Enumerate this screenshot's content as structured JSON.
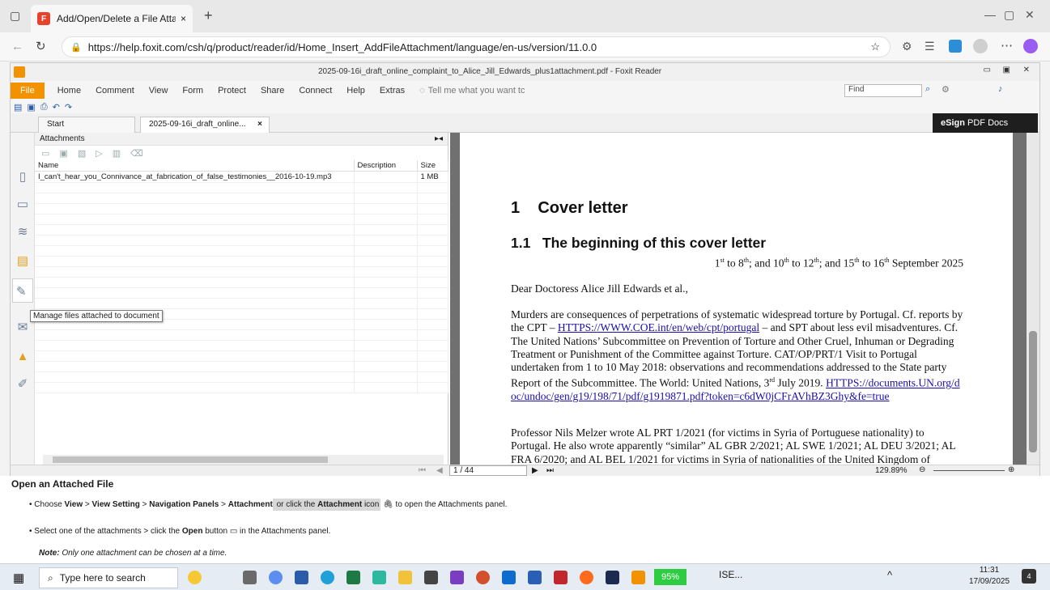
{
  "browser": {
    "tab_title": "Add/Open/Delete a File Attachme",
    "url": "https://help.foxit.com/csh/q/product/reader/id/Home_Insert_AddFileAttachment/language/en-us/version/11.0.0"
  },
  "foxit": {
    "window_title": "2025-09-16i_draft_online_complaint_to_Alice_Jill_Edwards_plus1attachment.pdf - Foxit Reader",
    "menu": [
      "Home",
      "Comment",
      "View",
      "Form",
      "Protect",
      "Share",
      "Connect",
      "Help",
      "Extras"
    ],
    "file_label": "File",
    "tell_me": "Tell me what you want tc",
    "find_placeholder": "Find",
    "tabs": {
      "start": "Start",
      "doc": "2025-09-16i_draft_online...",
      "close": "×"
    },
    "esign": {
      "bold": "eSign",
      "rest": "PDF Docs"
    },
    "attachments": {
      "title": "Attachments",
      "columns": [
        "Name",
        "Description",
        "Size"
      ],
      "rows": [
        {
          "name": "I_can't_hear_you_Connivance_at_fabrication_of_false_testimonies__2016-10-19.mp3",
          "description": "",
          "size": "1 MB"
        }
      ],
      "tooltip": "Manage files attached to document"
    },
    "document": {
      "h1_num": "1",
      "h1_text": "Cover letter",
      "h2_num": "1.1",
      "h2_text": "The beginning of this cover letter",
      "date_parts": [
        "1",
        "st",
        " to 8",
        "th",
        "; and 10",
        "th",
        " to 12",
        "th",
        "; and 15",
        "th",
        " to 16",
        "th",
        " September 2025"
      ],
      "salutation": "Dear Doctoress Alice Jill Edwards et al.,",
      "p1_a": "Murders are consequences of perpetrations of systematic widespread torture by Portugal. Cf. reports by the CPT – ",
      "p1_link": "HTTPS://WWW.COE.int/en/web/cpt/portugal",
      "p1_b": " – and SPT about less evil misadventures. Cf. The United Nations’ Subcommittee on Prevention of Torture and Other Cruel, Inhuman or Degrading Treatment or Punishment of the Committee against Torture. CAT/OP/PRT/1 Visit to Portugal undertaken from 1 to 10 May 2018: observations and recommendations addressed to the State party Report of the Subcommittee. The World: United Nations, 3",
      "p1_sup": "rd",
      "p1_c": " July 2019.",
      "p1_link2": "HTTPS://documents.UN.org/doc/undoc/gen/g19/198/71/pdf/g1919871.pdf?token=c6dW0jCFrAVhBZ3Ghy&fe=true",
      "p2": "Professor Nils Melzer wrote AL PRT 1/2021 (for victims in Syria of Portuguese nationality) to Portugal. He also wrote apparently “similar” AL GBR 2/2021; AL SWE 1/2021; AL DEU 3/2021; AL FRA 6/2020; and AL BEL 1/2021 for victims in Syria of nationalities of the United Kingdom of"
    },
    "status": {
      "page": "1 / 44",
      "zoom": "129.89%"
    }
  },
  "help": {
    "heading": "Open an Attached File",
    "li1": {
      "t1": "Choose ",
      "b1": "View",
      "t2": " > ",
      "b2": "View Setting",
      "t3": " > ",
      "b3": "Navigation Panels",
      "t4": " > ",
      "b4": "Attachment",
      "t5": " or click the ",
      "b5": "Attachment",
      "t6": " icon",
      "t7": " to open the Attachments panel."
    },
    "li2": {
      "t1": "Select one of the attachments > click the ",
      "b1": "Open",
      "t2": " button",
      "t3": " in the Attachments panel."
    },
    "note_label": "Note:",
    "note_text": " Only one attachment can be chosen at a time."
  },
  "taskbar": {
    "search_placeholder": "Type here to search",
    "battery": "95%",
    "app_label": "ISE...",
    "time": "11:31",
    "date": "17/09/2025",
    "notif_count": "4"
  }
}
